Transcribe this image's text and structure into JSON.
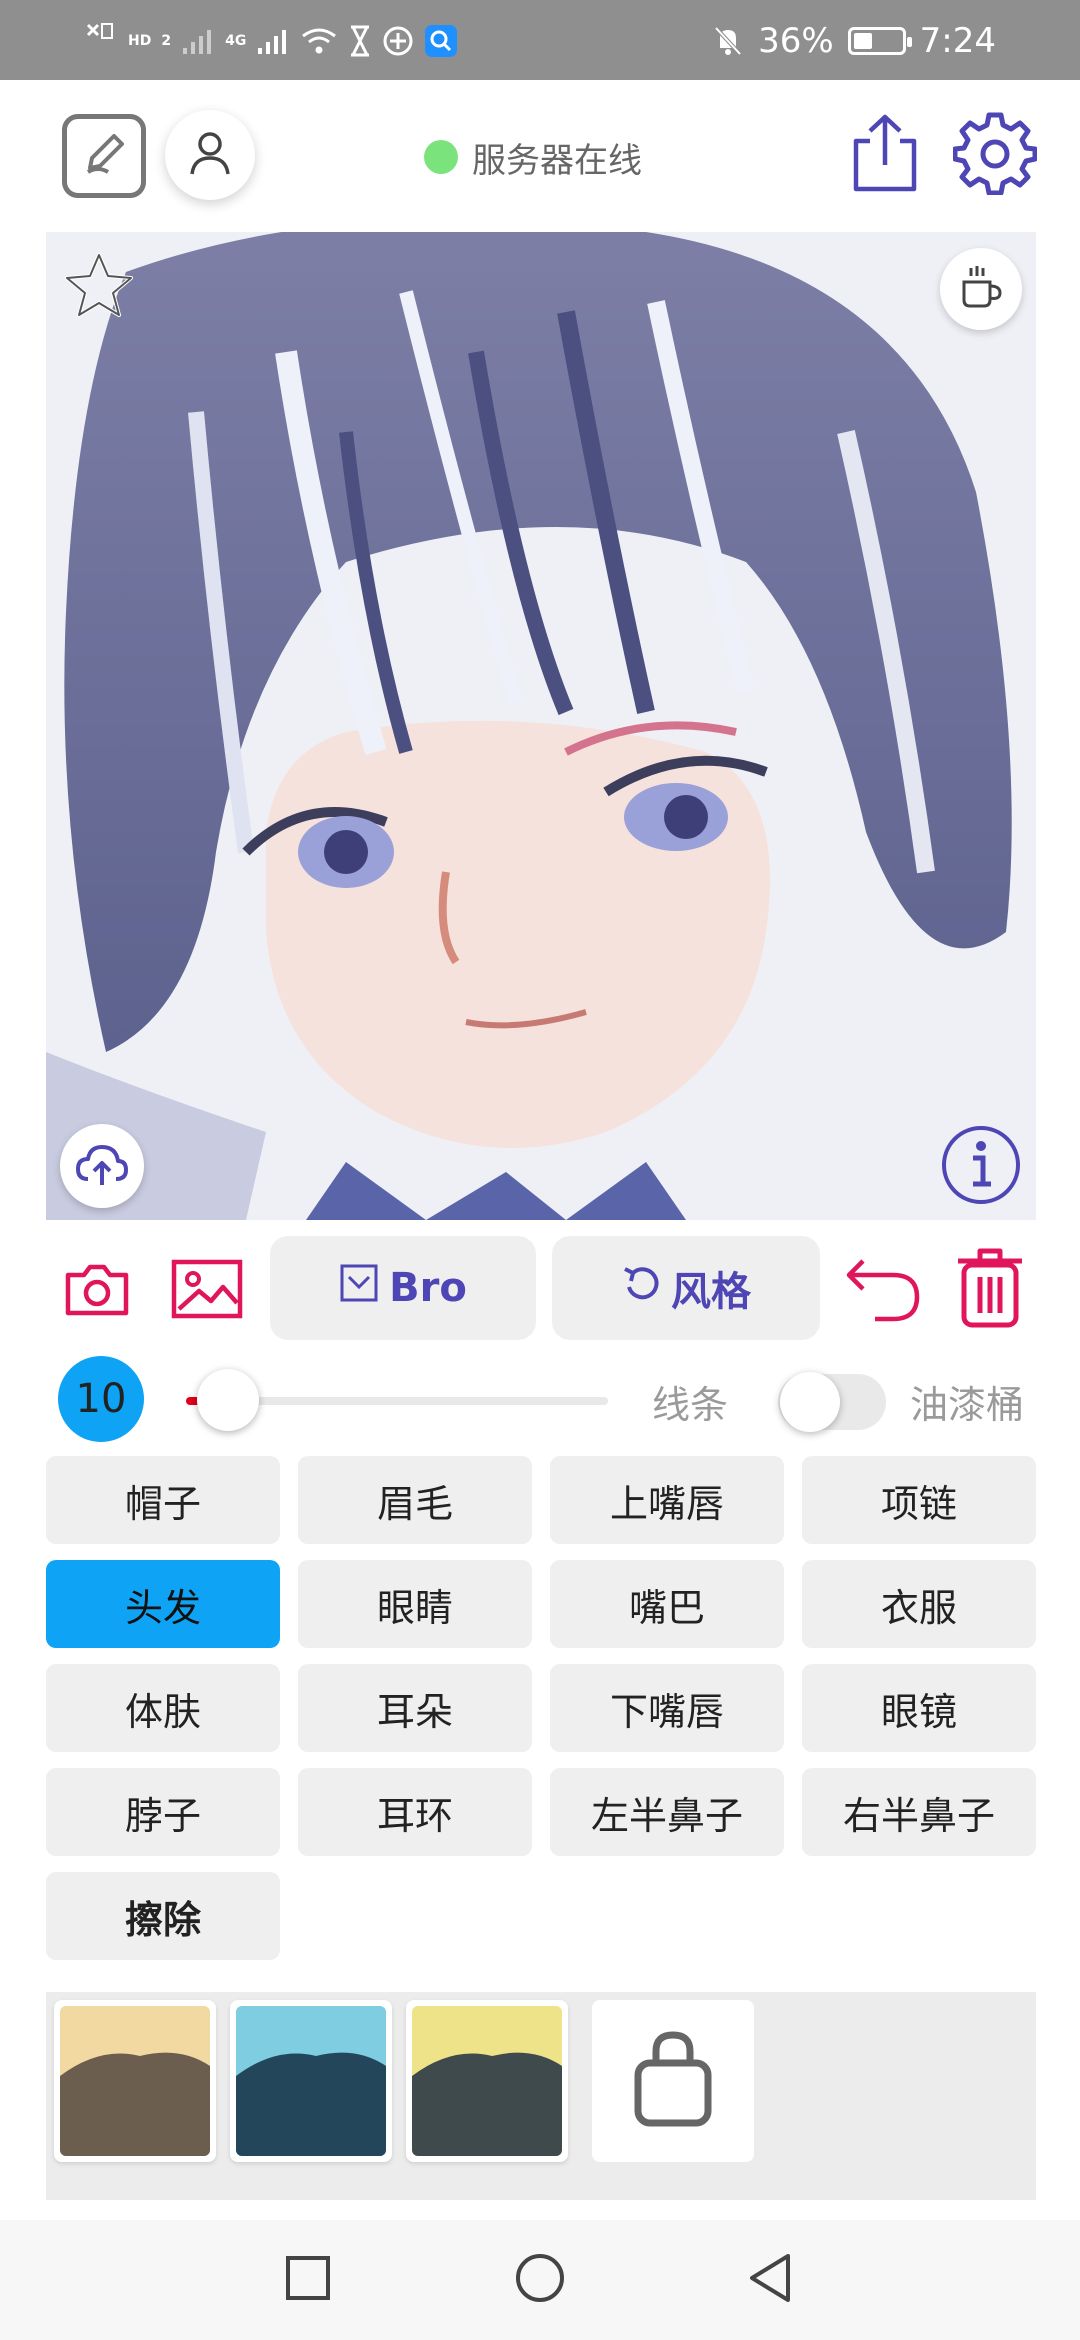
{
  "status_bar": {
    "hd_label": "HD",
    "sim_slot": "2",
    "network_type": "4G",
    "battery_percent": "36%",
    "battery_level": 0.36,
    "time": "7:24",
    "icons": [
      "sim-x-icon",
      "signal-weak-icon",
      "signal-4g-icon",
      "wifi-icon",
      "hourglass-icon",
      "vpn-icon",
      "search-app-icon",
      "mute-bell-icon",
      "battery-icon"
    ]
  },
  "header": {
    "server_status": "服务器在线",
    "server_status_color": "#7be37b",
    "icons": [
      "edit-icon",
      "user-icon",
      "share-icon",
      "settings-icon"
    ]
  },
  "canvas": {
    "icons": [
      "star-icon",
      "coffee-icon",
      "upload-cloud-icon",
      "info-icon"
    ]
  },
  "toolbar": {
    "bro_label": "Bro",
    "style_label": "风格",
    "accent_color": "#4d46b4",
    "danger_color": "#e0155c",
    "icons": [
      "camera-icon",
      "image-icon",
      "mail-icon",
      "refresh-icon",
      "undo-icon",
      "trash-icon"
    ]
  },
  "brush": {
    "size": "10",
    "slider_value": 0.1,
    "line_label": "线条",
    "bucket_label": "油漆桶",
    "bucket_enabled": false
  },
  "labels": [
    {
      "text": "帽子",
      "active": false,
      "bold": false
    },
    {
      "text": "眉毛",
      "active": false,
      "bold": false
    },
    {
      "text": "上嘴唇",
      "active": false,
      "bold": false
    },
    {
      "text": "项链",
      "active": false,
      "bold": false
    },
    {
      "text": "头发",
      "active": true,
      "bold": false
    },
    {
      "text": "眼睛",
      "active": false,
      "bold": false
    },
    {
      "text": "嘴巴",
      "active": false,
      "bold": false
    },
    {
      "text": "衣服",
      "active": false,
      "bold": false
    },
    {
      "text": "体肤",
      "active": false,
      "bold": false
    },
    {
      "text": "耳朵",
      "active": false,
      "bold": false
    },
    {
      "text": "下嘴唇",
      "active": false,
      "bold": false
    },
    {
      "text": "眼镜",
      "active": false,
      "bold": false
    },
    {
      "text": "脖子",
      "active": false,
      "bold": false
    },
    {
      "text": "耳环",
      "active": false,
      "bold": false
    },
    {
      "text": "左半鼻子",
      "active": false,
      "bold": false
    },
    {
      "text": "右半鼻子",
      "active": false,
      "bold": false
    },
    {
      "text": "擦除",
      "active": false,
      "bold": true
    }
  ],
  "palette": {
    "swatches": [
      {
        "sky": "#f2d9a2",
        "hill": "#6b5e4e"
      },
      {
        "sky": "#7fcde0",
        "hill": "#23465a"
      },
      {
        "sky": "#efe38a",
        "hill": "#3e4a4c"
      }
    ],
    "icons": [
      "bag-icon"
    ]
  },
  "nav": {
    "icons": [
      "recent-apps-icon",
      "home-icon",
      "back-icon"
    ]
  }
}
